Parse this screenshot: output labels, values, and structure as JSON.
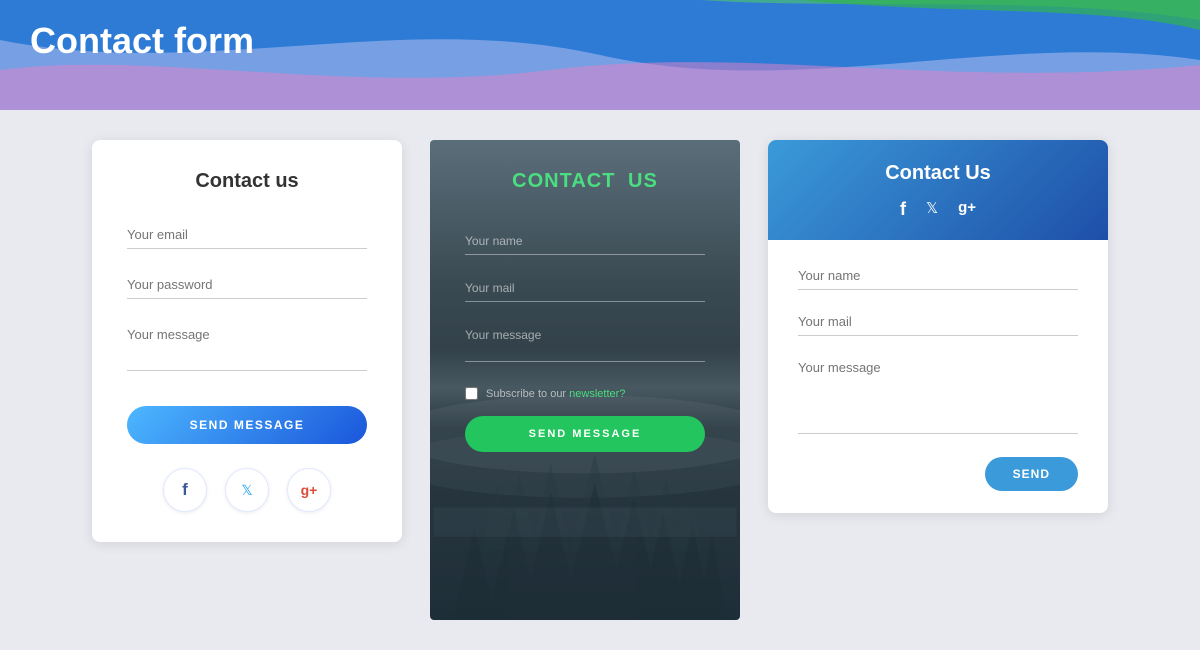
{
  "header": {
    "title": "Contact form"
  },
  "card1": {
    "title": "Contact us",
    "email_placeholder": "Your email",
    "password_placeholder": "Your password",
    "message_placeholder": "Your message",
    "send_label": "SEND MESSAGE",
    "social": {
      "facebook": "f",
      "twitter": "t",
      "googleplus": "g+"
    }
  },
  "card2": {
    "title_part1": "CONTACT",
    "title_part2": "US",
    "name_placeholder": "Your name",
    "mail_placeholder": "Your mail",
    "message_placeholder": "Your message",
    "subscribe_text": "Subscribe to our",
    "newsletter_link": "newsletter?",
    "send_label": "SEND MESSAGE"
  },
  "card3": {
    "title": "Contact Us",
    "name_placeholder": "Your name",
    "mail_placeholder": "Your mail",
    "message_placeholder": "Your message",
    "send_label": "SEND",
    "social": {
      "facebook": "f",
      "twitter": "t",
      "googleplus": "g+"
    }
  }
}
